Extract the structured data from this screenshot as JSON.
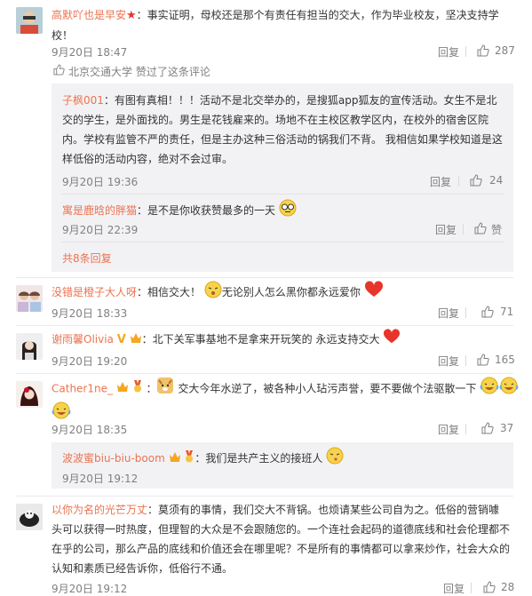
{
  "comments": [
    {
      "user": "高默吖也是早安",
      "text1": "：事实证明，母校还是那个有责任有担当的交大，作为毕业校友，坚决支持学",
      "text2": "校！",
      "time": "9月20日 18:47",
      "reply": "回复",
      "likes": "287",
      "liked_by": "北京交通大学 赞过了这条评论",
      "sub": [
        {
          "user": "子枫001",
          "lines": [
            "：有图有真相！！！活动不是北交举办的，是搜狐app狐友的宣传活动。女生不是北",
            "交的学生，是外面找的。男生是花钱雇来的。场地不在主校区教学区内，在校外的宿舍区院",
            "内。学校有监管不严的责任，但是主办这种三俗活动的锅我们不背。 我相信如果学校知道是这",
            "样低俗的活动内容，绝对不会过审。"
          ],
          "time": "9月20日 19:36",
          "reply": "回复",
          "likes": "24"
        },
        {
          "user": "寓是鹿晗的胖猫",
          "text": "：是不是你收获赞最多的一天",
          "time": "9月20日 22:39",
          "reply": "回复",
          "likes": "赞"
        }
      ],
      "more": "共8条回复"
    },
    {
      "user": "没错是橙子大人呀",
      "text1": "：相信交大！",
      "text2": "无论别人怎么黑你都永远爱你",
      "time": "9月20日 18:33",
      "reply": "回复",
      "likes": "71"
    },
    {
      "user": "谢雨馨Olivia",
      "text": "：北下关军事基地不是拿来开玩笑的 永远支持交大",
      "time": "9月20日 19:20",
      "reply": "回复",
      "likes": "165"
    },
    {
      "user": "Cather1ne_",
      "text": "交大今年水逆了，被各种小人玷污声誉，要不要做个法驱散一下",
      "time": "9月20日 18:35",
      "reply": "回复",
      "likes": "37",
      "sub": [
        {
          "user": "波波蜜biu-biu-boom",
          "text": "：我们是共产主义的接班人",
          "time": "9月20日 19:12"
        }
      ]
    },
    {
      "user": "以你为名的光芒万丈",
      "lines": [
        "：莫须有的事情，我们交大不背锅。也烦请某些公司自为之。低俗的营销噱",
        "头可以获得一时热度，但理智的大众是不会跟随您的。一个连社会起码的道德底线和社会伦理都不",
        "在乎的公司，那么产品的底线和价值还会在哪里呢？不是所有的事情都可以拿来炒作，社会大众的",
        "认知和素质已经告诉你，低俗行不通。"
      ],
      "time": "9月20日 19:12",
      "reply": "回复",
      "likes": "28"
    }
  ],
  "colors": {
    "username": "#eb7350",
    "meta": "#808080",
    "sub_bg": "#f2f2f5",
    "separator": "#eaeaea"
  }
}
